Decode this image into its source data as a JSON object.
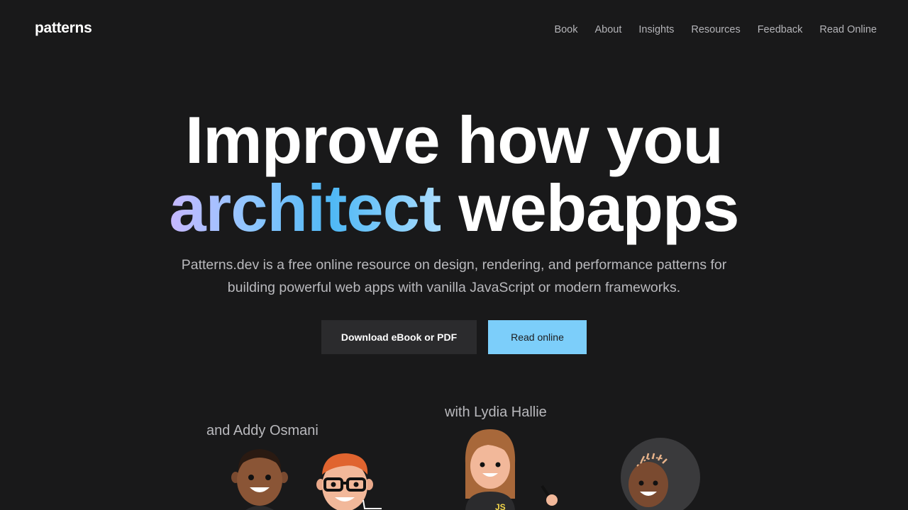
{
  "header": {
    "logo": "patterns",
    "nav": [
      "Book",
      "About",
      "Insights",
      "Resources",
      "Feedback",
      "Read Online"
    ]
  },
  "hero": {
    "line1": "Improve how you",
    "line2_accent": "architect",
    "line2_rest": " webapps",
    "subtitle": "Patterns.dev is a free online resource on design, rendering, and performance patterns for building powerful web apps with vanilla JavaScript or modern frameworks."
  },
  "buttons": {
    "download": "Download eBook or PDF",
    "read": "Read online"
  },
  "authors": {
    "addy_caption": "and Addy Osmani",
    "lydia_caption": "with Lydia Hallie",
    "shirt_text": "JS"
  },
  "colors": {
    "background": "#19191a",
    "accent": "#7ccefa",
    "nav_text": "#b4b4b8"
  }
}
